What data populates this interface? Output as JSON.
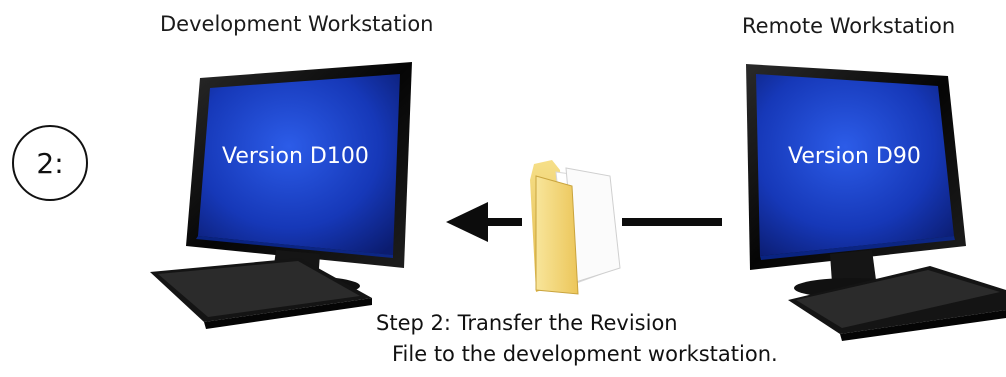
{
  "step_badge": "2:",
  "dev_workstation": {
    "title": "Development Workstation",
    "screen_text": "Version D100"
  },
  "remote_workstation": {
    "title": "Remote Workstation",
    "screen_text": "Version D90"
  },
  "caption": {
    "line1": "Step 2: Transfer the Revision",
    "line2": "File to the development workstation."
  },
  "colors": {
    "screen_blue": "#1638b8",
    "monitor_black": "#0c0c0c",
    "folder_yellow": "#f2d56a"
  },
  "icons": [
    "monitor-icon",
    "keyboard-icon",
    "folder-icon",
    "arrow-left-icon"
  ]
}
